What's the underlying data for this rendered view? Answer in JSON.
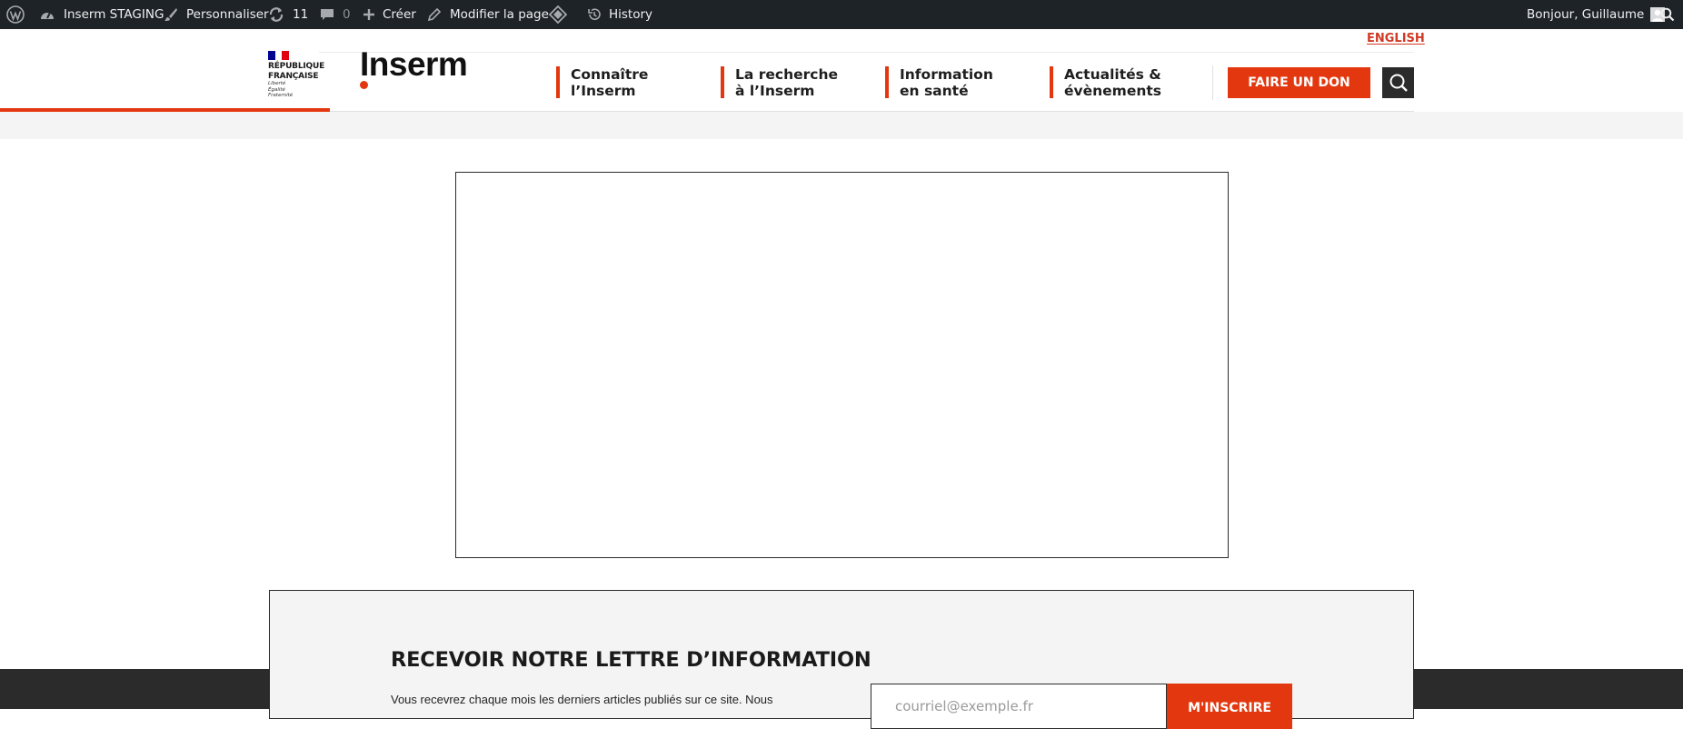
{
  "admin_bar": {
    "site_name": "Inserm STAGING",
    "customize": "Personnaliser",
    "updates_count": "11",
    "comments_count": "0",
    "new": "Créer",
    "edit_page": "Modifier la page",
    "history": "History",
    "greeting": "Bonjour, Guillaume"
  },
  "header": {
    "language_link": "ENGLISH",
    "republic": {
      "line1": "RÉPUBLIQUE",
      "line2": "FRANÇAISE",
      "motto1": "Liberté",
      "motto2": "Égalité",
      "motto3": "Fraternité"
    },
    "logo_text": "Inserm",
    "nav": [
      {
        "line1": "Connaître",
        "line2": "l’Inserm"
      },
      {
        "line1": "La recherche",
        "line2": "à l’Inserm"
      },
      {
        "line1": "Information",
        "line2": "en santé"
      },
      {
        "line1": "Actualités &",
        "line2": "évènements"
      }
    ],
    "donate_button": "FAIRE UN DON"
  },
  "newsletter": {
    "title": "RECEVOIR NOTRE LETTRE D’INFORMATION",
    "text": "Vous recevrez chaque mois les derniers articles publiés sur ce site. Nous",
    "email_placeholder": "courriel@exemple.fr",
    "subscribe_button": "M'INSCRIRE"
  },
  "colors": {
    "admin_bar": "#1d2327",
    "accent": "#e3380f",
    "dark": "#2b2b2b",
    "light_grey": "#f4f4f4"
  }
}
